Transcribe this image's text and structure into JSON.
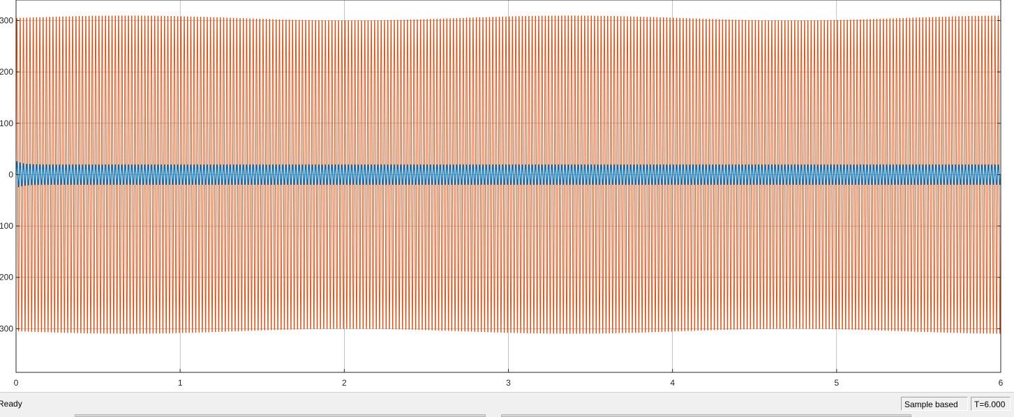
{
  "status_bar": {
    "status": "Ready",
    "mode": "Sample based",
    "time": "T=6.000"
  },
  "colors": {
    "signal_1": "#d95319",
    "signal_2": "#0072bd",
    "axes_background": "#ffffff",
    "grid": "#262626"
  },
  "chart_data": {
    "type": "line",
    "title": "",
    "xlabel": "",
    "ylabel": "",
    "xlim": [
      0,
      6
    ],
    "ylim": [
      -385,
      340
    ],
    "x_ticks": [
      0,
      1,
      2,
      3,
      4,
      5,
      6
    ],
    "x_tick_labels": [
      "0",
      "1",
      "2",
      "3",
      "4",
      "5",
      "6"
    ],
    "y_ticks": [
      -300,
      -200,
      -100,
      0,
      100,
      200,
      300
    ],
    "y_tick_labels": [
      "300",
      "200",
      "100",
      "0",
      "100",
      "200",
      "300"
    ],
    "grid": true,
    "series": [
      {
        "color": "#d95319",
        "shape": "sinusoid",
        "frequency_hz": 50,
        "amplitude": 315,
        "amplitude_max": 325,
        "t_start": 0,
        "t_end": 6
      },
      {
        "color": "#0072bd",
        "shape": "sinusoid",
        "frequency_hz": 50,
        "amplitude": 20,
        "initial_peak": 27,
        "t_start": 0,
        "t_end": 6
      }
    ]
  }
}
